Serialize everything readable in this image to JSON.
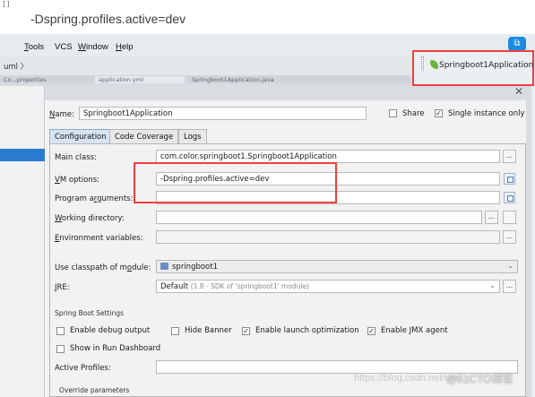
{
  "caption": "-Dspring.profiles.active=dev",
  "corner_mark": "[]",
  "menu": {
    "items": [
      {
        "label": "Tools",
        "u": "T",
        "rest": "ools"
      },
      {
        "label": "VCS",
        "u": "",
        "rest": "VCS"
      },
      {
        "label": "Window",
        "u": "W",
        "rest": "indow"
      },
      {
        "label": "Help",
        "u": "H",
        "rest": "elp"
      }
    ]
  },
  "breadcrumb": "uml 〉",
  "editor_tabs": [
    "Co...properties",
    "application.yml",
    "Springboot1Application.java"
  ],
  "run_config": {
    "label": "Springboot1Application"
  },
  "dialog": {
    "name_label_u": "N",
    "name_label_rest": "ame:",
    "name_value": "Springboot1Application",
    "share_label": "Share",
    "single_instance_label": "Single instance only",
    "tabs": [
      "Configuration",
      "Code Coverage",
      "Logs"
    ],
    "main_class_label": "Main class:",
    "main_class_value": "com.color.springboot1.Springboot1Application",
    "vm_options_label_u": "V",
    "vm_options_label_rest": "M options:",
    "vm_options_value": "-Dspring.profiles.active=dev",
    "program_args_label": "Program a",
    "program_args_label_u": "r",
    "program_args_label_rest": "guments:",
    "program_args_value": "",
    "working_dir_label_u": "W",
    "working_dir_label_rest": "orking directory:",
    "working_dir_value": "",
    "env_vars_label_u": "E",
    "env_vars_label_rest": "nvironment variables:",
    "env_vars_value": "",
    "classpath_label": "Use classpath of m",
    "classpath_label_u": "o",
    "classpath_label_rest": "dule:",
    "classpath_value": "springboot1",
    "jre_label_u": "J",
    "jre_label_rest": "RE:",
    "jre_value": "Default",
    "jre_detail": "(1.8 - SDK of 'springboot1' module)",
    "spring_boot_section": "Spring Boot Settings",
    "enable_debug_label": "Enable debug output",
    "enable_debug_u": "d",
    "hide_banner_label": "Hide Banner",
    "hide_banner_u": "H",
    "launch_opt_label": "Enable launch optimization",
    "launch_opt_u": "l",
    "jmx_label": "Enable JMX agent",
    "jmx_u": "M",
    "run_dashboard_label": "Show in Run Dashboard",
    "active_profiles_label": "Active Profiles:",
    "active_profiles_value": "",
    "override_params_label": "Override parameters",
    "checkmark": "✓",
    "ellipsis": "..."
  },
  "watermark": "https://blog.csdn.net/wei",
  "watermark2": "@51CTO博客"
}
